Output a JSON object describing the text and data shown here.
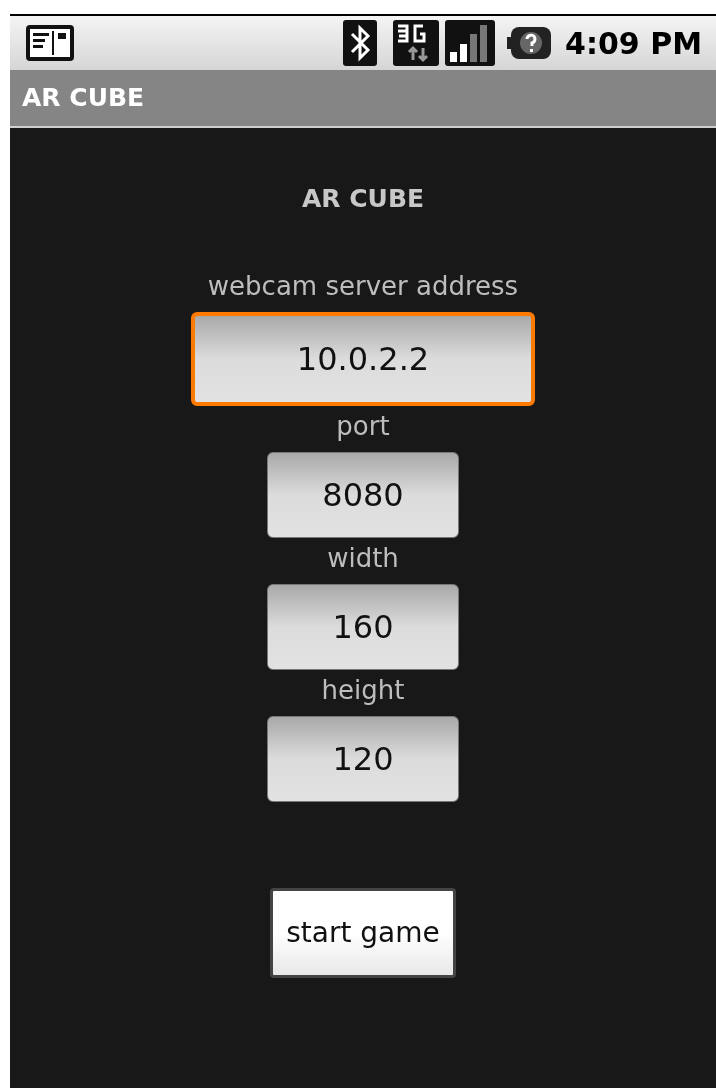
{
  "status_bar": {
    "time": "4:09 PM"
  },
  "title_bar": {
    "title": "AR CUBE"
  },
  "heading": "AR CUBE",
  "fields": [
    {
      "label": "webcam server address",
      "value": "10.0.2.2",
      "focused": true,
      "kind": "wide"
    },
    {
      "label": "port",
      "value": "8080",
      "focused": false,
      "kind": "narrow"
    },
    {
      "label": "width",
      "value": "160",
      "focused": false,
      "kind": "narrow"
    },
    {
      "label": "height",
      "value": "120",
      "focused": false,
      "kind": "narrow"
    }
  ],
  "button": "start game"
}
